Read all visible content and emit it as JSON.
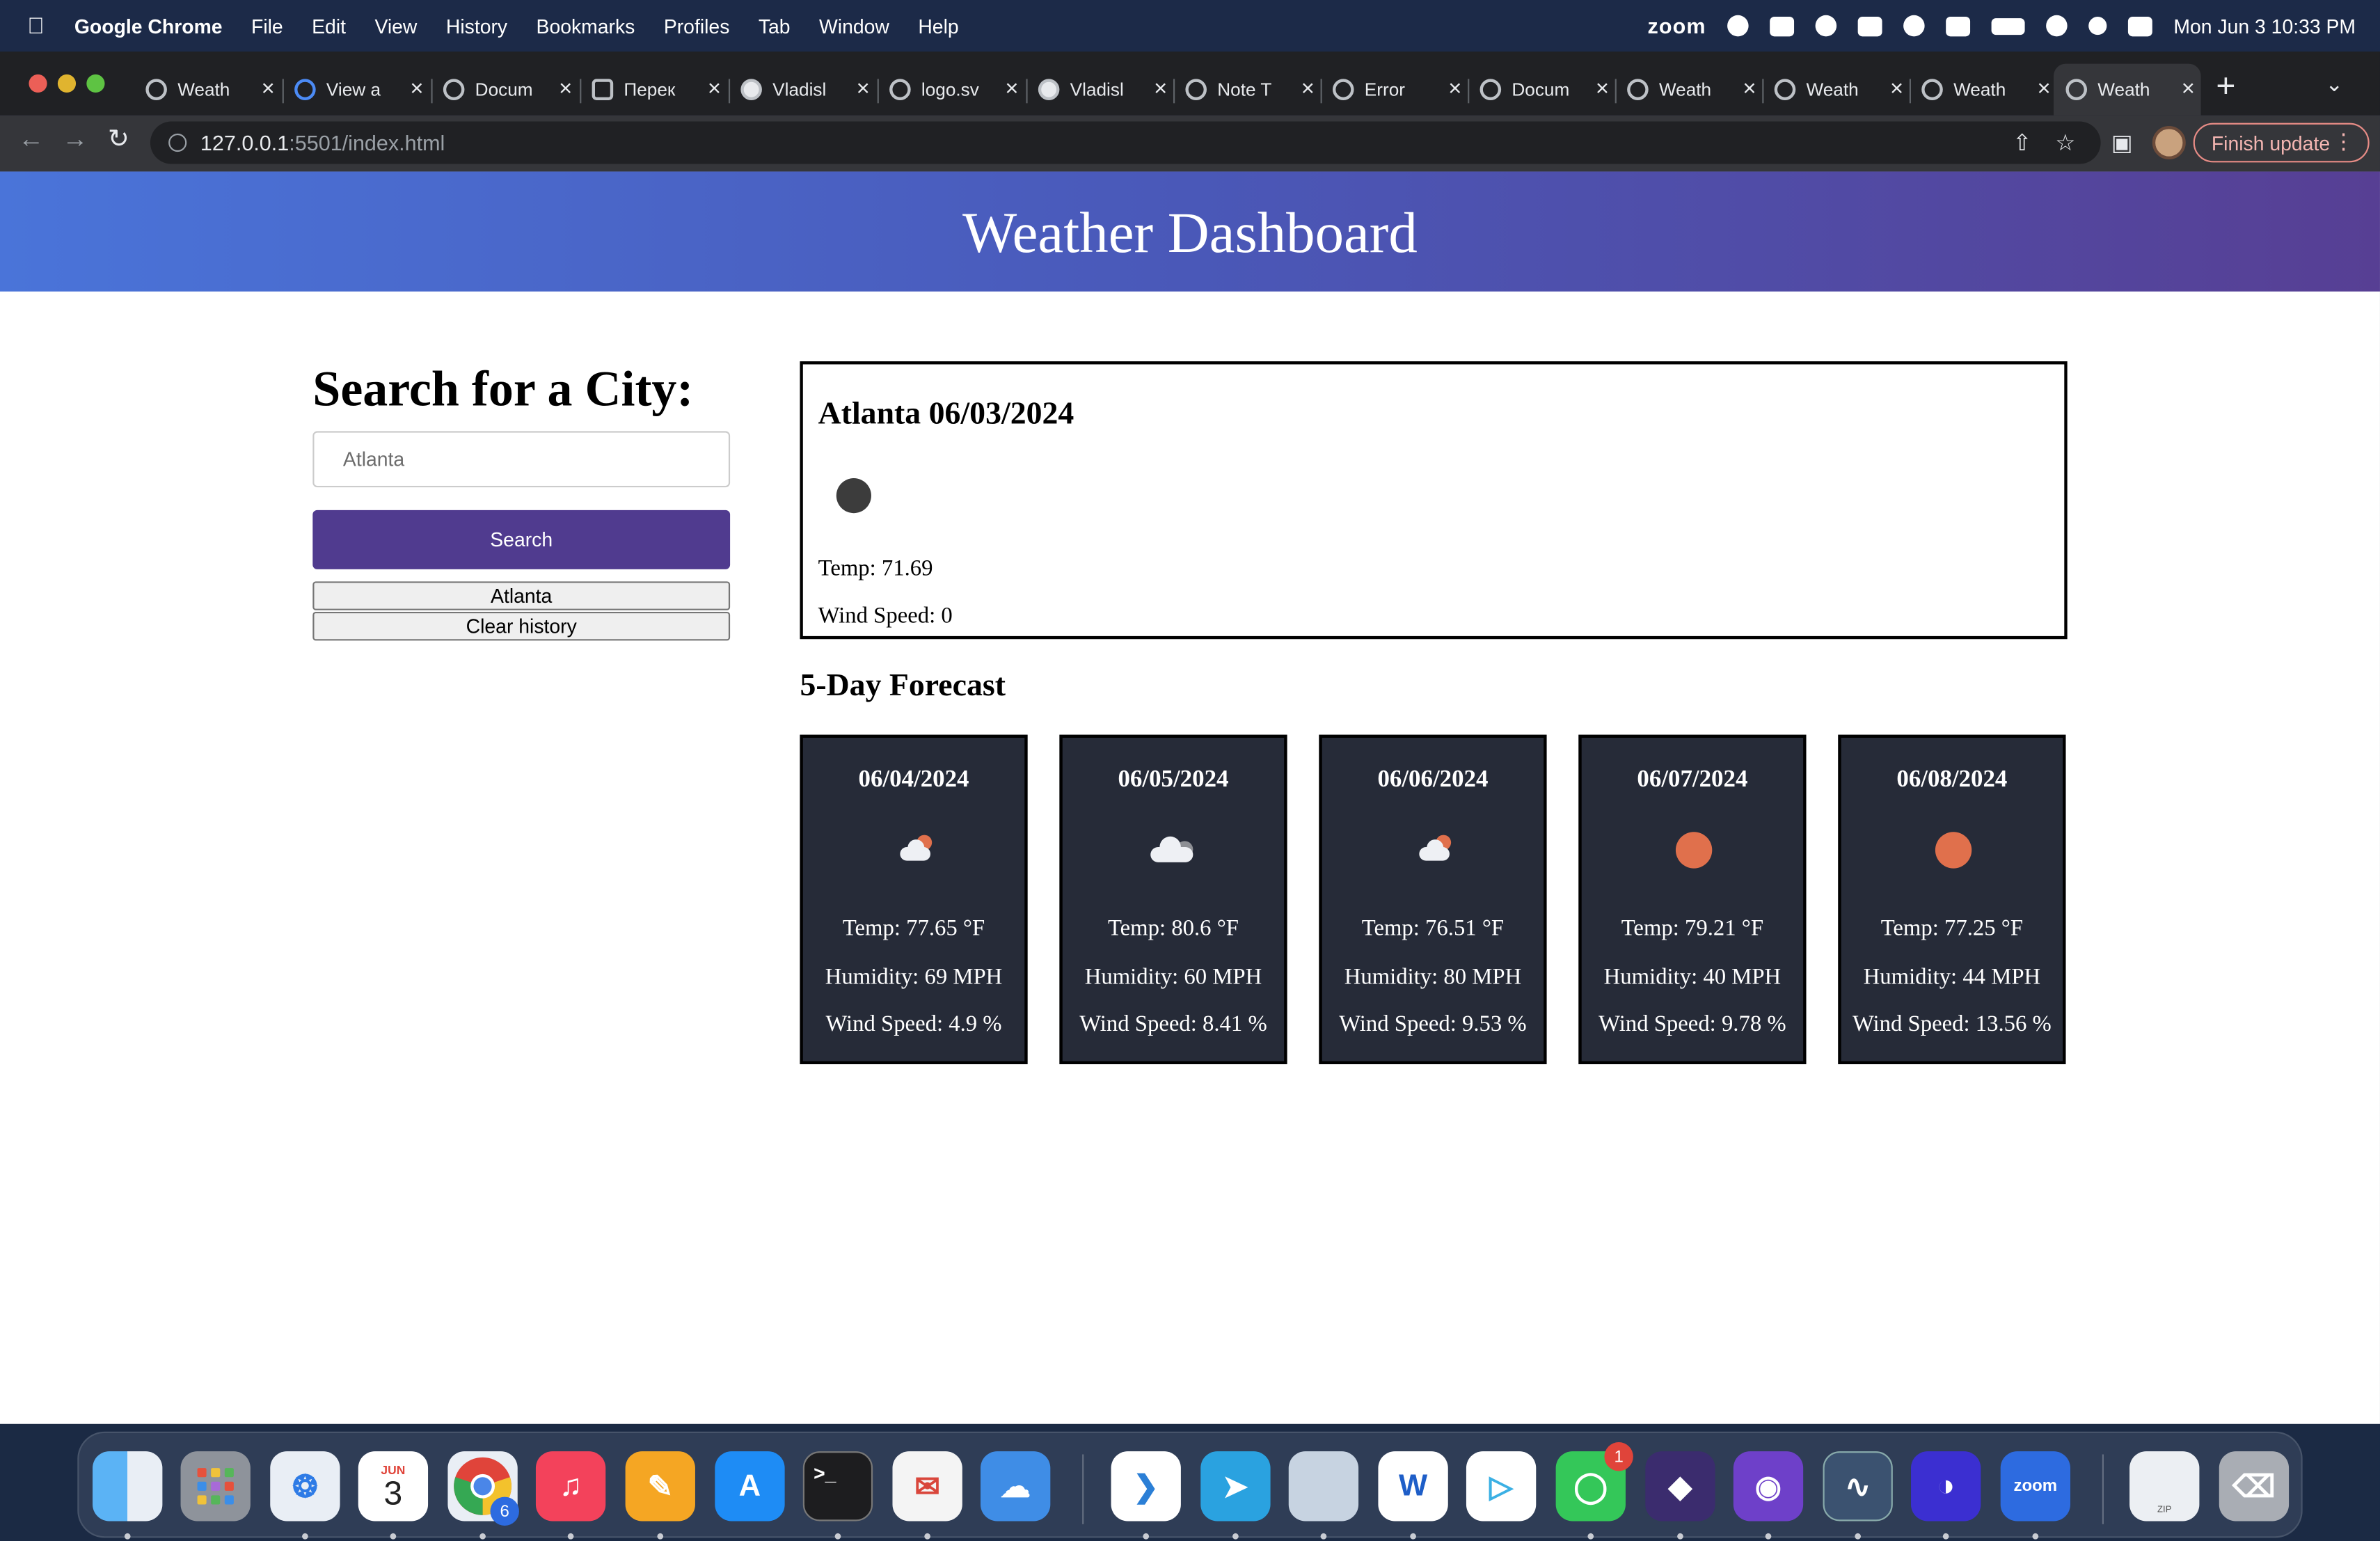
{
  "menubar": {
    "app_name": "Google Chrome",
    "menus": [
      "File",
      "Edit",
      "View",
      "History",
      "Bookmarks",
      "Profiles",
      "Tab",
      "Window",
      "Help"
    ],
    "zoom_label": "zoom",
    "clock": "Mon Jun 3  10:33 PM"
  },
  "tabs": [
    {
      "title": "Weath",
      "active": false
    },
    {
      "title": "View a",
      "active": false
    },
    {
      "title": "Docum",
      "active": false
    },
    {
      "title": "Перек",
      "active": false
    },
    {
      "title": "Vladisl",
      "active": false
    },
    {
      "title": "logo.sv",
      "active": false
    },
    {
      "title": "Vladisl",
      "active": false
    },
    {
      "title": "Note T",
      "active": false
    },
    {
      "title": "Error",
      "active": false
    },
    {
      "title": "Docum",
      "active": false
    },
    {
      "title": "Weath",
      "active": false
    },
    {
      "title": "Weath",
      "active": false
    },
    {
      "title": "Weath",
      "active": false
    },
    {
      "title": "Weath",
      "active": true
    }
  ],
  "toolbar": {
    "url_host": "127.0.0.1",
    "url_path": ":5501/index.html",
    "finish_update": "Finish update"
  },
  "page": {
    "header_title": "Weather Dashboard",
    "search_title": "Search for a City:",
    "search_input_value": "Atlanta",
    "search_button": "Search",
    "history": [
      "Atlanta"
    ],
    "clear_history": "Clear history",
    "current": {
      "heading": "Atlanta 06/03/2024",
      "temp": "Temp: 71.69",
      "wind": "Wind Speed: 0"
    },
    "forecast_title": "5-Day Forecast",
    "forecast": [
      {
        "date": "06/04/2024",
        "icon": "partly-cloudy-icon",
        "temp": "Temp: 77.65 °F",
        "humidity": "Humidity: 69 MPH",
        "wind": "Wind Speed: 4.9 %"
      },
      {
        "date": "06/05/2024",
        "icon": "cloudy-icon",
        "temp": "Temp: 80.6 °F",
        "humidity": "Humidity: 60 MPH",
        "wind": "Wind Speed: 8.41 %"
      },
      {
        "date": "06/06/2024",
        "icon": "partly-cloudy-icon",
        "temp": "Temp: 76.51 °F",
        "humidity": "Humidity: 80 MPH",
        "wind": "Wind Speed: 9.53 %"
      },
      {
        "date": "06/07/2024",
        "icon": "sun-icon",
        "temp": "Temp: 79.21 °F",
        "humidity": "Humidity: 40 MPH",
        "wind": "Wind Speed: 9.78 %"
      },
      {
        "date": "06/08/2024",
        "icon": "sun-icon",
        "temp": "Temp: 77.25 °F",
        "humidity": "Humidity: 44 MPH",
        "wind": "Wind Speed: 13.56 %"
      }
    ]
  },
  "dock": {
    "calendar_month": "JUN",
    "calendar_day": "3",
    "chrome_badge": "6",
    "messages_badge": "1",
    "zoom_label": "zoom",
    "zip_label": "ZIP"
  },
  "colors": {
    "header_gradient_start": "#4a74d9",
    "header_gradient_end": "#573f94",
    "search_button": "#503b8f",
    "card_bg": "#262b38"
  }
}
